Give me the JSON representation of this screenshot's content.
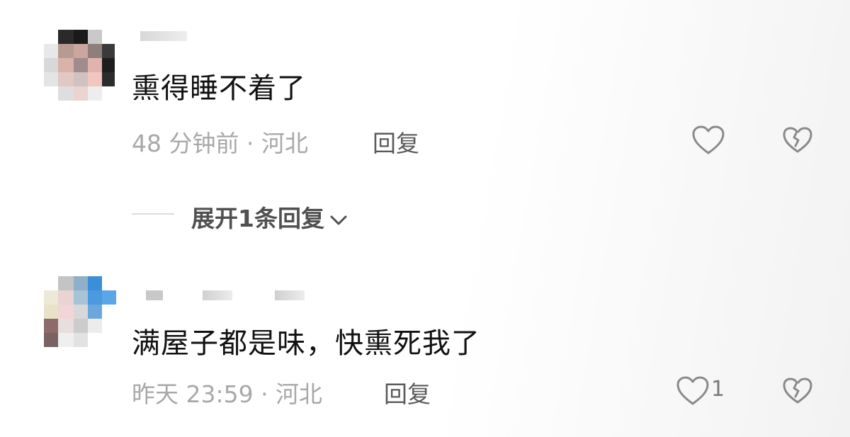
{
  "comments": [
    {
      "text": "熏得睡不着了",
      "time": "48 分钟前 · 河北",
      "reply_label": "回复",
      "like_count": ""
    },
    {
      "text": "满屋子都是味，快熏死我了",
      "time": "昨天 23:59 · 河北",
      "reply_label": "回复",
      "like_count": "1"
    }
  ],
  "expand": {
    "label": "展开1条回复"
  },
  "icons": {
    "like": "heart-outline-icon",
    "dislike": "broken-heart-icon",
    "expand": "chevron-down-icon"
  },
  "colors": {
    "text": "#111111",
    "meta": "#a8a8a8",
    "icon": "#8a8a8a"
  }
}
